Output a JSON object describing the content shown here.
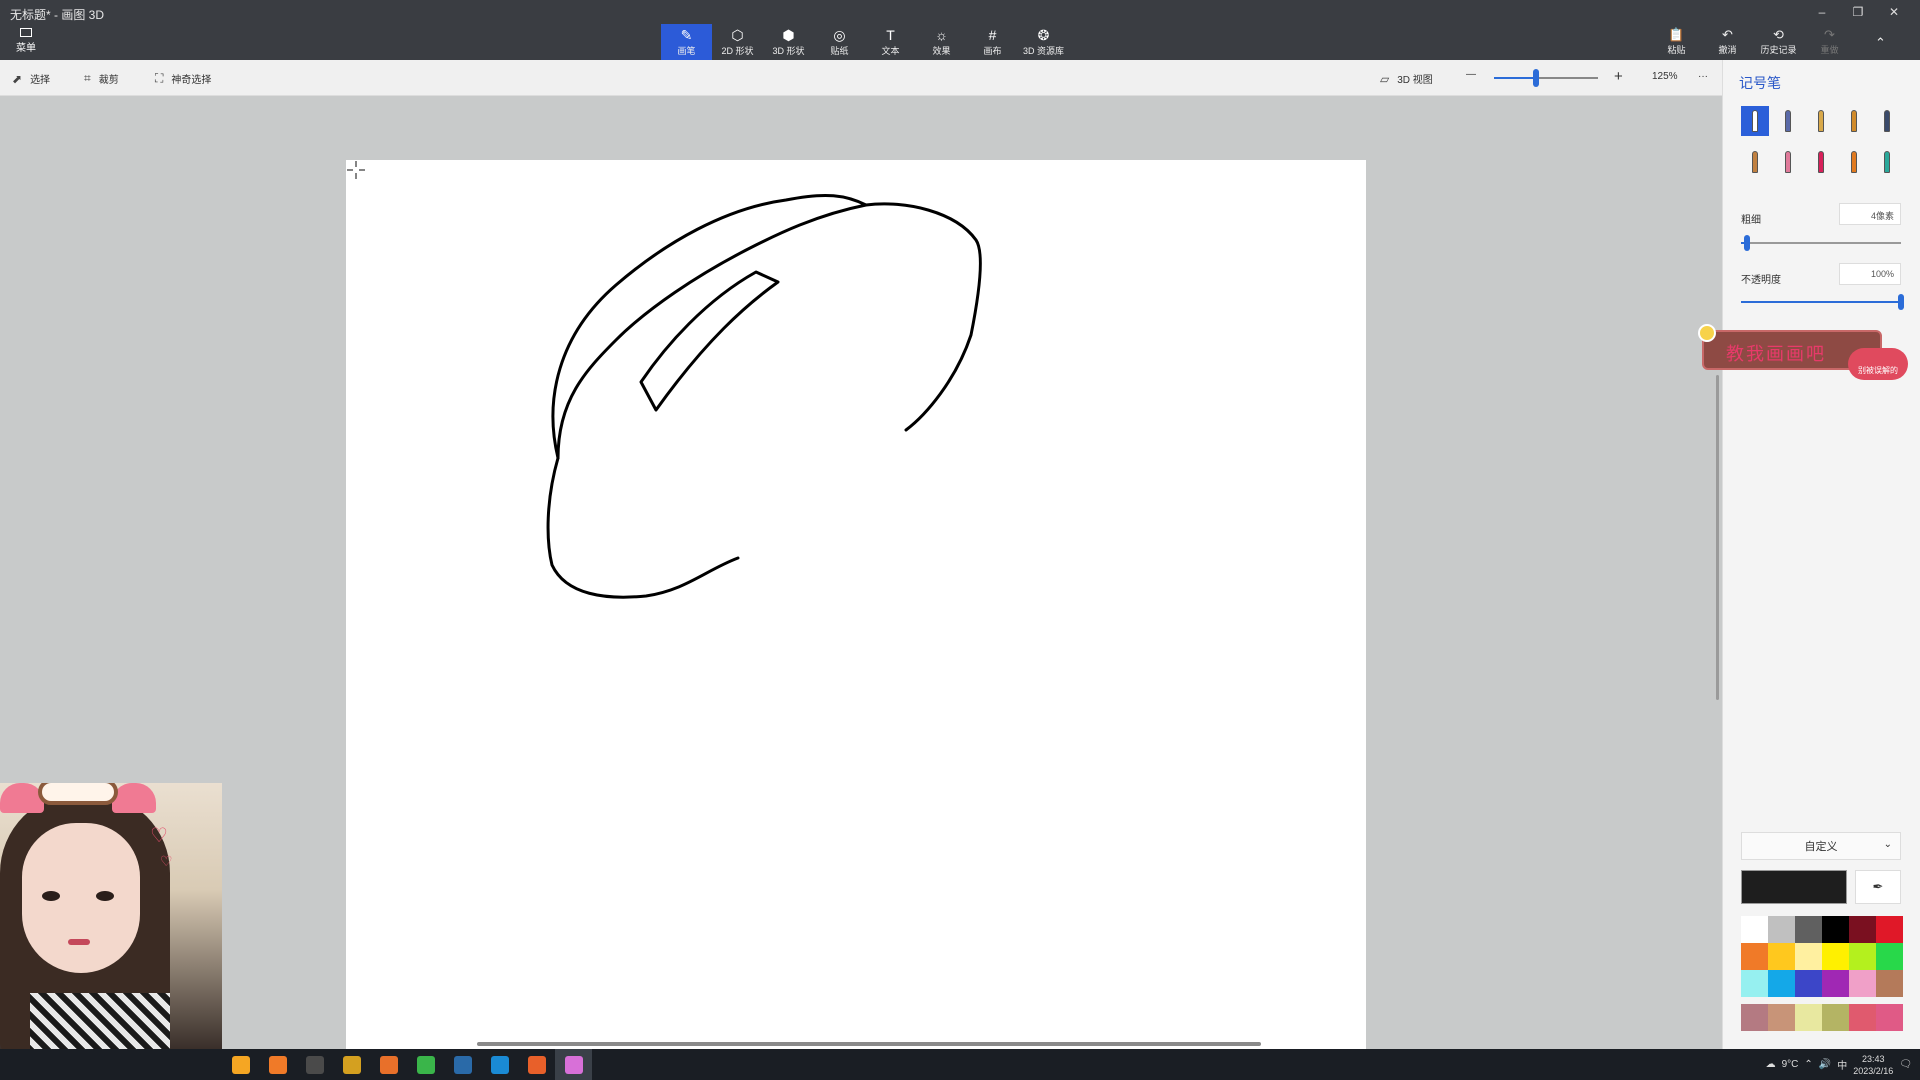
{
  "window": {
    "title": "无标题* - 画图 3D",
    "minimize": "–",
    "maximize": "❐",
    "close": "✕"
  },
  "menu": {
    "label": "菜单"
  },
  "tools": [
    {
      "label": "画笔",
      "glyph": "✎",
      "icon": "brush-icon",
      "active": true
    },
    {
      "label": "2D 形状",
      "glyph": "⬡",
      "icon": "2d-shapes-icon",
      "active": false
    },
    {
      "label": "3D 形状",
      "glyph": "⬢",
      "icon": "3d-shapes-icon",
      "active": false
    },
    {
      "label": "贴纸",
      "glyph": "◎",
      "icon": "stickers-icon",
      "active": false
    },
    {
      "label": "文本",
      "glyph": "T",
      "icon": "text-icon",
      "active": false
    },
    {
      "label": "效果",
      "glyph": "☼",
      "icon": "effects-icon",
      "active": false
    },
    {
      "label": "画布",
      "glyph": "#",
      "icon": "canvas-icon",
      "active": false
    },
    {
      "label": "3D 资源库",
      "glyph": "❂",
      "icon": "3d-library-icon",
      "active": false
    }
  ],
  "right_tools": [
    {
      "label": "粘贴",
      "glyph": "📋",
      "icon": "paste-icon",
      "disabled": false
    },
    {
      "label": "撤消",
      "glyph": "↶",
      "icon": "undo-icon",
      "disabled": false
    },
    {
      "label": "历史记录",
      "glyph": "⟲",
      "icon": "history-icon",
      "disabled": false
    },
    {
      "label": "重做",
      "glyph": "↷",
      "icon": "redo-icon",
      "disabled": true
    }
  ],
  "collapse_glyph": "⌃",
  "subbar": {
    "select": "选择",
    "crop": "裁剪",
    "magic_select": "神奇选择",
    "view3d": "3D 视图",
    "zoom_out": "—",
    "zoom_in": "+",
    "zoom_percent": "125%",
    "zoom_level": 0.4,
    "more": "···"
  },
  "panel": {
    "title": "记号笔",
    "brushes": [
      {
        "name": "marker",
        "color": "#ffffff",
        "active": true
      },
      {
        "name": "calligraphy-pen",
        "color": "#5a6aa8"
      },
      {
        "name": "oil-brush",
        "color": "#d9a94a"
      },
      {
        "name": "watercolor",
        "color": "#d08a2a"
      },
      {
        "name": "pixel-pen",
        "color": "#3a4a6a"
      },
      {
        "name": "pencil",
        "color": "#c08040"
      },
      {
        "name": "eraser",
        "color": "#e07a9a"
      },
      {
        "name": "crayon",
        "color": "#d8205a"
      },
      {
        "name": "spray-can",
        "color": "#e07a20"
      },
      {
        "name": "fill",
        "color": "#2aa89a"
      }
    ],
    "thickness_label": "粗细",
    "thickness_value": "4像素",
    "thickness_level": 0.04,
    "opacity_label": "不透明度",
    "opacity_value": "100%",
    "opacity_level": 1.0,
    "color_mode": "自定义",
    "current_color": "#1e1e1e",
    "palette": [
      "#ffffff",
      "#c0c0c0",
      "#606060",
      "#000000",
      "#7a1020",
      "#e01828",
      "#f07a28",
      "#ffc81e",
      "#fff0a0",
      "#fff000",
      "#b4f01e",
      "#28d84a",
      "#96f0f0",
      "#14a8e8",
      "#3c46c8",
      "#a028b4",
      "#f0a0c8",
      "#b47a5a"
    ],
    "palette2": [
      "#b47a82",
      "#c89478",
      "#e8e8a0",
      "#b4b464",
      "#e05a6e",
      "#e05a86"
    ]
  },
  "sticker": {
    "text": "教我画画吧",
    "badge": "别被误解的"
  },
  "taskbar": {
    "apps": [
      {
        "icon": "paint-palette-icon",
        "color": "#f5a623"
      },
      {
        "icon": "question-app-icon",
        "color": "#f07a28"
      },
      {
        "icon": "clock-app-icon",
        "color": "#4a4a4a"
      },
      {
        "icon": "owl-app-icon",
        "color": "#d4a020"
      },
      {
        "icon": "game-app-icon",
        "color": "#e8702a"
      },
      {
        "icon": "chrome-icon",
        "color": "#3ab54a"
      },
      {
        "icon": "steam-icon",
        "color": "#2a6aa8"
      },
      {
        "icon": "edge-icon",
        "color": "#1a8ad4"
      },
      {
        "icon": "g-app-icon",
        "color": "#e8602a"
      },
      {
        "icon": "paint3d-icon",
        "color": "#d870d8",
        "active": true
      }
    ],
    "weather": "9°C",
    "ime": "中",
    "time": "23:43",
    "date": "2023/2/16"
  }
}
